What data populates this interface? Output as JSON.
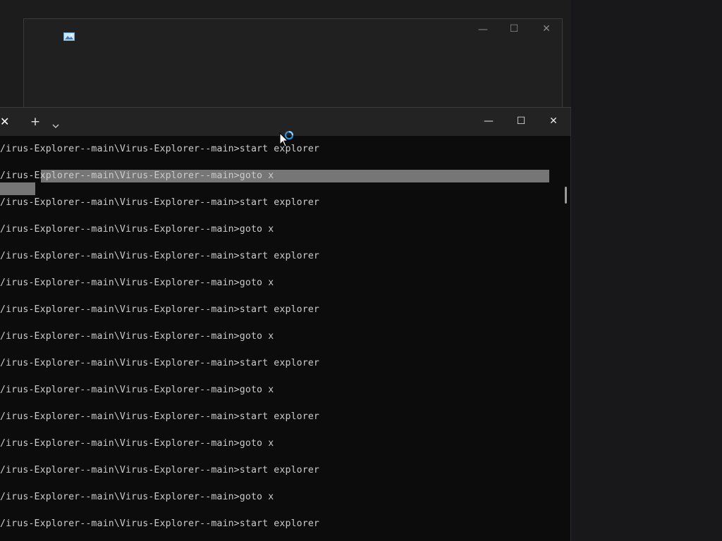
{
  "background_window": {
    "title": "",
    "icon": "image-app-icon",
    "controls": {
      "minimize": "—",
      "maximize": "☐",
      "close": "✕"
    }
  },
  "terminal": {
    "tab": {
      "close_glyph": "✕"
    },
    "new_tab_glyph": "+",
    "dropdown_icon": "chevron-down-icon",
    "controls": {
      "minimize": "—",
      "maximize": "☐",
      "close": "✕"
    },
    "lines": [
      "/irus-Explorer--main\\Virus-Explorer--main>start explorer",
      "/irus-Explorer--main\\Virus-Explorer--main>goto x",
      "/irus-Explorer--main\\Virus-Explorer--main>start explorer",
      "/irus-Explorer--main\\Virus-Explorer--main>goto x",
      "/irus-Explorer--main\\Virus-Explorer--main>start explorer",
      "/irus-Explorer--main\\Virus-Explorer--main>goto x",
      "/irus-Explorer--main\\Virus-Explorer--main>start explorer",
      "/irus-Explorer--main\\Virus-Explorer--main>goto x",
      "/irus-Explorer--main\\Virus-Explorer--main>start explorer",
      "/irus-Explorer--main\\Virus-Explorer--main>goto x",
      "/irus-Explorer--main\\Virus-Explorer--main>start explorer",
      "/irus-Explorer--main\\Virus-Explorer--main>goto x",
      "/irus-Explorer--main\\Virus-Explorer--main>start explorer",
      "/irus-Explorer--main\\Virus-Explorer--main>goto x",
      "/irus-Explorer--main\\Virus-Explorer--main>start explorer"
    ]
  },
  "cursor": {
    "icon": "arrow-pointer-icon",
    "busy_icon": "busy-ring-icon"
  },
  "colors": {
    "terminal_bg": "#0c0c0c",
    "terminal_text": "#cccccc",
    "titlebar": "#232323",
    "selection": "#8a8a8a",
    "busy_accent": "#2b8fd9"
  }
}
